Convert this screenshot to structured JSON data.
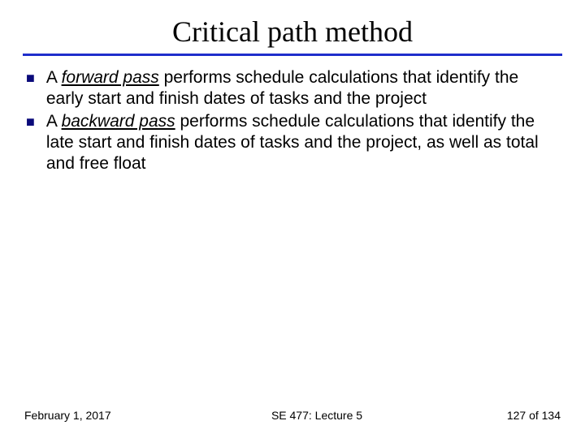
{
  "title": "Critical path method",
  "bullets": [
    {
      "lead": "A ",
      "term": "forward pass",
      "tail": " performs schedule calculations that identify the early start and finish dates of tasks and the project"
    },
    {
      "lead": "A ",
      "term": "backward pass",
      "tail": " performs schedule calculations that identify the late start and finish dates of tasks and the project, as well as total and free float"
    }
  ],
  "footer": {
    "date": "February 1, 2017",
    "course": "SE 477: Lecture 5",
    "page": "127 of 134"
  }
}
